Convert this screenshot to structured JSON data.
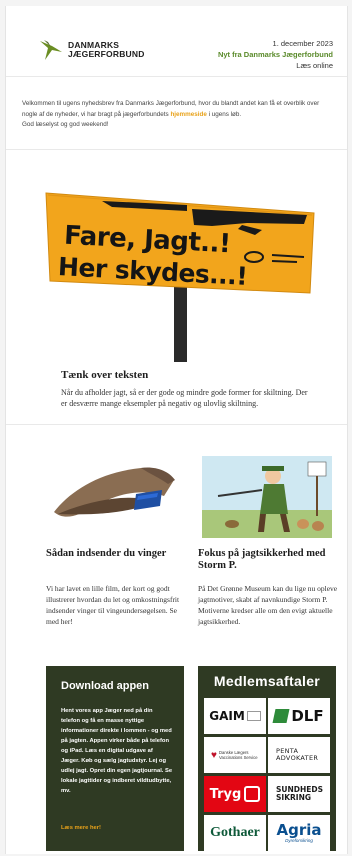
{
  "header": {
    "logo_line1": "DANMARKS",
    "logo_line2": "JÆGERFORBUND",
    "date": "1. december 2023",
    "newsletter_title": "Nyt fra Danmarks Jægerforbund",
    "read_online": "Læs online"
  },
  "intro": {
    "text_before": "Velkommen til ugens nyhedsbrev fra Danmarks Jægerforbund, hvor du blandt andet kan få et overblik over nogle af de nyheder, vi har bragt på jægerforbundets ",
    "link": "hjemmeside",
    "text_after": " i ugens løb.",
    "line2": "God læselyst og god weekend!"
  },
  "hero": {
    "sign_line1": "Fare, Jagt..!",
    "sign_line2": "Her skydes...!",
    "title": "Tænk over teksten",
    "body": "Når du afholder jagt, så er der gode og mindre gode former for skiltning. Der er desværre mange eksempler på negativ og ulovlig skiltning."
  },
  "articles": [
    {
      "title": "Sådan indsender du vinger",
      "body": "Vi har lavet en lille film, der kort og godt illustrerer hvordan du let og omkostningsfrit indsender vinger til vingeundersøgelsen. Se med her!"
    },
    {
      "title": "Fokus på jagtsikkerhed med Storm P.",
      "body": "På Det Grønne Museum kan du lige nu opleve jagtmotiver, skabt af navnkundige Storm P. Motiverne kredser alle om den evigt aktuelle jagtsikkerhed."
    }
  ],
  "app_promo": {
    "title": "Download appen",
    "body": "Hent vores app Jæger ned på din telefon og få en masse nyttige informationer direkte i lommen - og med på jagten. Appen virker både på telefon og iPad. Læs en digital udgave af Jæger. Køb og sælg jagtudstyr. Lej og udlej jagt. Opret din egen jagtjournal. Se lokale jagttider og indberet vildtudbytte, mv.",
    "more": "Læs mere her!"
  },
  "members": {
    "title": "Medlemsaftaler",
    "partners": [
      "GAIM",
      "DLF",
      "Danske Lægers Vaccinations Service",
      "PENTA ADVOKATER",
      "Tryg",
      "SUNDHEDS SIKRING",
      "Gothaer",
      "Agria",
      "Dyreforsikring"
    ]
  },
  "colors": {
    "accent_green": "#5a8a2a",
    "link_orange": "#e8a21a",
    "dark_panel": "#2f3a23"
  }
}
